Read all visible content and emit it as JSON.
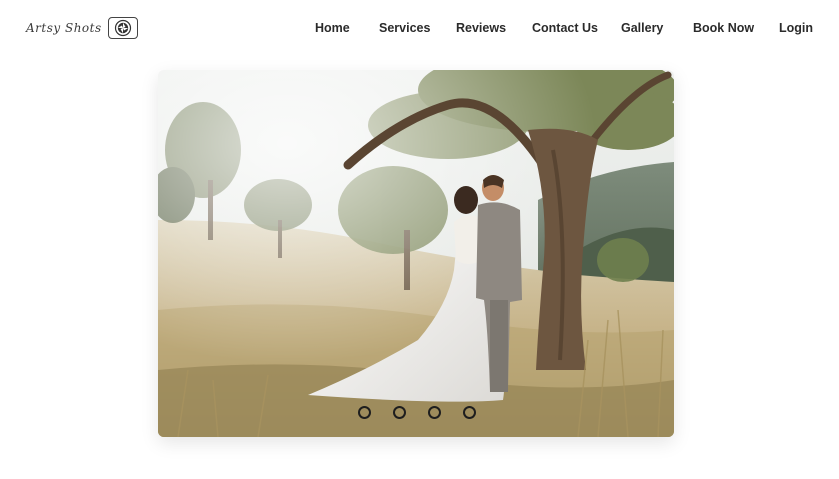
{
  "logo": {
    "text": "Artsy Shots",
    "mark_icon": "camera-aperture-icon"
  },
  "nav": {
    "items": [
      {
        "label": "Home"
      },
      {
        "label": "Services"
      },
      {
        "label": "Reviews"
      },
      {
        "label": "Contact Us"
      },
      {
        "label": "Gallery"
      },
      {
        "label": "Book Now"
      },
      {
        "label": "Login"
      }
    ]
  },
  "slider": {
    "image": "photo-wedding-couple-under-tree",
    "slide_count": 4,
    "dot_icon": "carousel-dot-icon"
  },
  "colors": {
    "text": "#2b2b2b",
    "background": "#ffffff",
    "dot": "#1e1e1e"
  }
}
